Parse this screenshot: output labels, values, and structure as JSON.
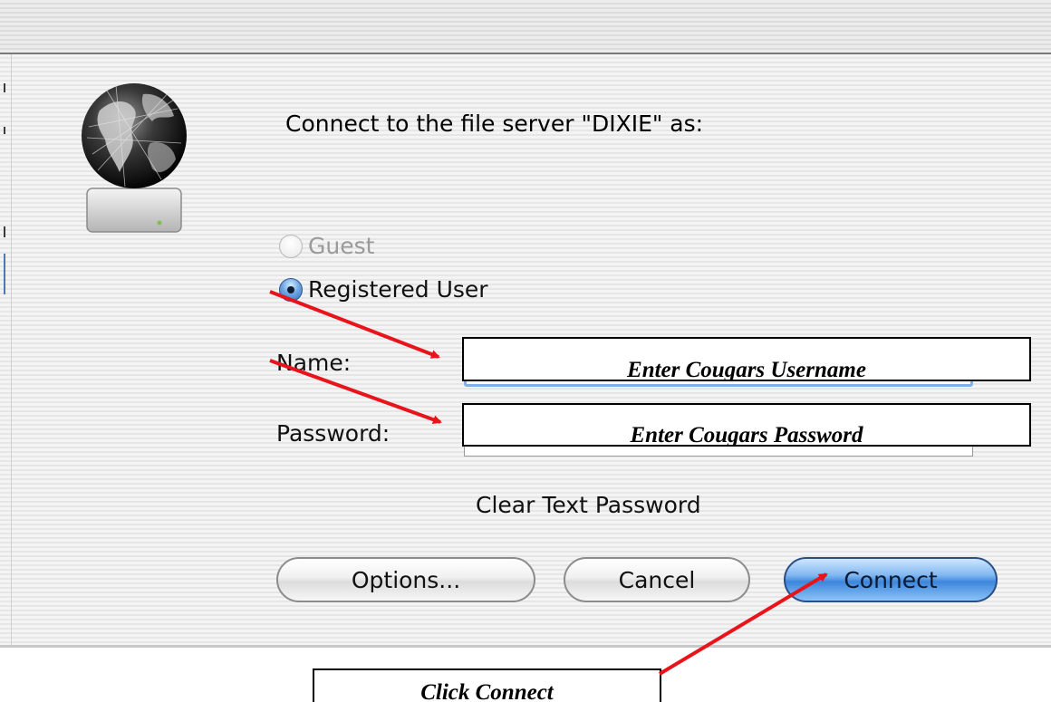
{
  "dialog": {
    "prompt": "Connect to the file server \"DIXIE\" as:",
    "server_icon": "globe-server-icon",
    "login_options": [
      {
        "label": "Guest",
        "selected": false,
        "enabled": false
      },
      {
        "label": "Registered User",
        "selected": true,
        "enabled": true
      }
    ],
    "name_label": "Name:",
    "password_label": "Password:",
    "name_value": "",
    "password_value": "",
    "security_note": "Clear Text Password",
    "buttons": {
      "options": "Options...",
      "cancel": "Cancel",
      "connect": "Connect"
    }
  },
  "annotations": {
    "username_callout": "Enter Cougars Username",
    "password_callout": "Enter Cougars Password",
    "connect_callout": "Click Connect",
    "arrow_color": "#e8141b"
  },
  "colors": {
    "default_button": "#3d86dc",
    "focus_ring": "#7fb0e6"
  }
}
